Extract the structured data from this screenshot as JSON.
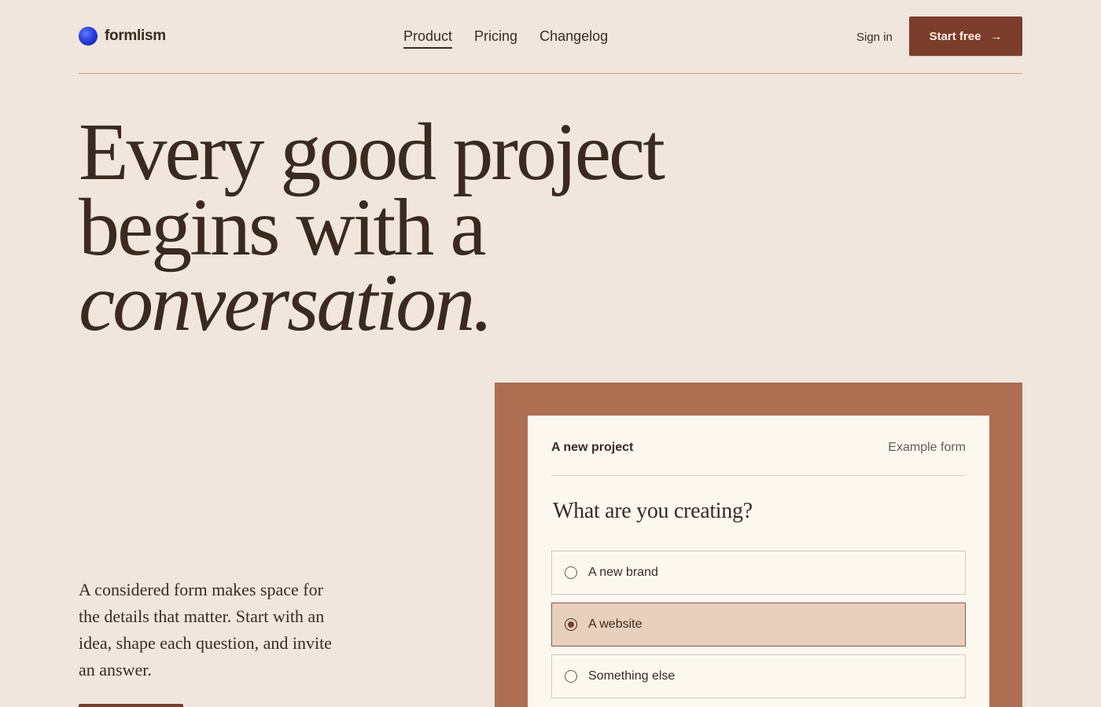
{
  "brand": {
    "name": "formlism"
  },
  "nav": {
    "items": [
      {
        "label": "Product",
        "active": true
      },
      {
        "label": "Pricing",
        "active": false
      },
      {
        "label": "Changelog",
        "active": false
      }
    ]
  },
  "header": {
    "sign_in": "Sign in",
    "start_free": "Start free"
  },
  "hero": {
    "line1": "Every good project",
    "line2": "begins with a",
    "line3": "conversation.",
    "lede": "A considered form makes space for the details that matter. Start with an idea, shape each question, and invite an answer."
  },
  "form": {
    "title": "A new project",
    "tag": "Example form",
    "question": "What are you creating?",
    "options": [
      {
        "label": "A new brand",
        "selected": false
      },
      {
        "label": "A website",
        "selected": true
      },
      {
        "label": "Something else",
        "selected": false
      }
    ]
  },
  "colors": {
    "background": "#f0e6dd",
    "accent": "#7b3d2c",
    "panel": "#ad6e52",
    "card": "#fcf8f0",
    "selected": "#e8d0bc",
    "text": "#3a2a22"
  },
  "icons": {
    "logo": "blue-orb-icon",
    "cta": "arrow-right-icon",
    "radio": "radio-icon"
  }
}
